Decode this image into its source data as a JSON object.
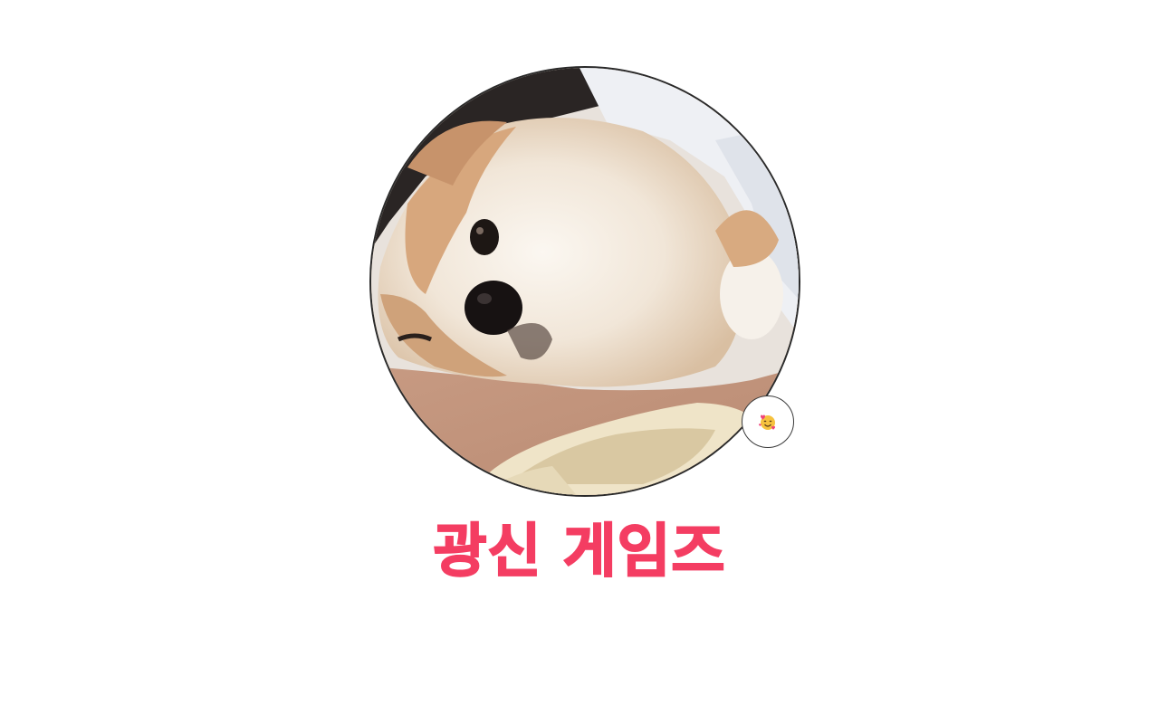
{
  "profile": {
    "display_name": "광신 게임즈",
    "avatar_icon": "shiba-dog-photo",
    "status_emoji_icon": "smiling-face-with-hearts-icon",
    "accent_color": "#f43d62"
  }
}
